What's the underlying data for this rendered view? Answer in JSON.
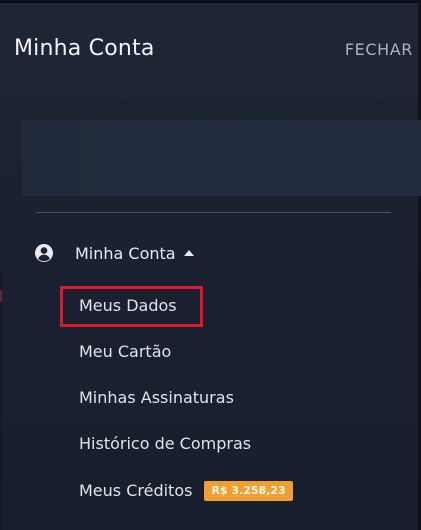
{
  "header": {
    "title": "Minha Conta",
    "close_label": "FECHAR"
  },
  "section": {
    "label": "Minha Conta",
    "expanded": true,
    "icon": "user-circle-icon",
    "caret_icon": "caret-up-icon"
  },
  "menu": {
    "items": [
      {
        "label": "Meus Dados",
        "highlighted": true
      },
      {
        "label": "Meu Cartão"
      },
      {
        "label": "Minhas Assinaturas"
      },
      {
        "label": "Histórico de Compras"
      },
      {
        "label": "Meus Créditos",
        "badge": "R$ 3.258,23"
      }
    ]
  },
  "colors": {
    "background": "#1a2130",
    "highlight_border": "#e0182a",
    "badge_bg": "#f0a030"
  }
}
